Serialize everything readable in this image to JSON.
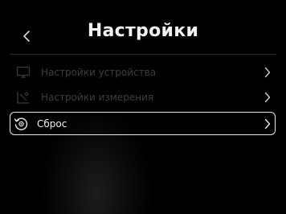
{
  "header": {
    "title": "Настройки",
    "back_icon": "chevron-left-icon"
  },
  "menu": {
    "items": [
      {
        "label": "Настройки устройства",
        "icon": "monitor-icon",
        "state": "disabled"
      },
      {
        "label": "Настройки измерения",
        "icon": "measurement-icon",
        "state": "disabled"
      },
      {
        "label": "Сброс",
        "icon": "reset-icon",
        "state": "selected"
      }
    ]
  },
  "colors": {
    "background": "#000000",
    "text_primary": "#f0f0f0",
    "text_disabled": "#3e3e3e",
    "selection_border": "#e8e8e8"
  }
}
